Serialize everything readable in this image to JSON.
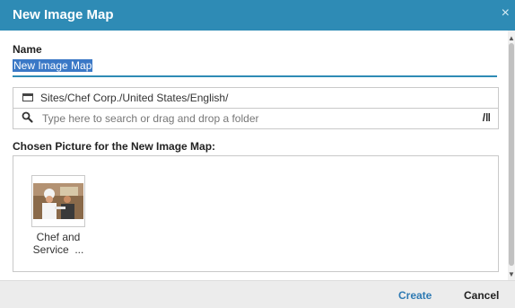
{
  "dialog": {
    "title": "New Image Map",
    "close_glyph": "×"
  },
  "name_field": {
    "label": "Name",
    "value": "New Image Map"
  },
  "folder_picker": {
    "path": "Sites/Chef Corp./United States/English/",
    "search_placeholder": "Type here to search or drag and drop a folder",
    "toggle_glyph": "/‖"
  },
  "picture": {
    "label": "Chosen Picture for the New Image Map:",
    "caption_line1": "Chef and",
    "caption_line2": "Service  ..."
  },
  "footer": {
    "create_label": "Create",
    "cancel_label": "Cancel"
  },
  "colors": {
    "accent": "#2e8bb5",
    "selection": "#3a78c6",
    "link": "#2e7ab3"
  },
  "icons": [
    "close-icon",
    "folder-icon",
    "search-icon",
    "folder-browse-icon"
  ]
}
